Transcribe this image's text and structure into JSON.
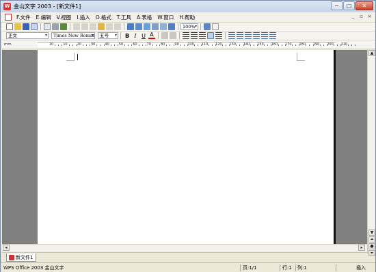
{
  "window": {
    "title": "金山文字 2003 - [新文件1]",
    "controls": {
      "minimize": "─",
      "maximize": "□",
      "close": "✕"
    }
  },
  "menu": {
    "items": [
      "F.文件",
      "E.编辑",
      "V.视图",
      "I.插入",
      "O.格式",
      "T.工具",
      "A.表格",
      "W.窗口",
      "H.帮助"
    ],
    "right_controls": [
      "_",
      "▫",
      "×"
    ]
  },
  "toolbar1": {
    "zoom": "100%"
  },
  "toolbar2": {
    "style": "正文",
    "font": "Times New Roman",
    "size": "五号",
    "bold": "B",
    "italic": "I",
    "underline": "U",
    "font_color": "A"
  },
  "ruler": {
    "unit_label": "mm",
    "labels": [
      "10",
      "10",
      "20",
      "30",
      "40",
      "50",
      "60",
      "70",
      "80",
      "90",
      "100",
      "110",
      "120",
      "130",
      "140",
      "150",
      "160",
      "170",
      "180",
      "190",
      "200",
      "210"
    ]
  },
  "tabs": [
    {
      "label": "新文件1"
    }
  ],
  "status": {
    "product": "WPS Office 2003 金山文字",
    "page": "页:1/1",
    "row": "行:1",
    "col": "列:1",
    "mode": "插入"
  },
  "icons": {
    "toolbar1": [
      "new-icon",
      "open-icon",
      "save-icon",
      "email-icon",
      "print-preview-icon",
      "print-icon",
      "spellcheck-icon",
      "cut-icon",
      "copy-icon",
      "paste-icon",
      "format-painter-icon",
      "undo-icon",
      "redo-icon",
      "hyperlink-icon",
      "table-icon",
      "insert-picture-icon",
      "columns-icon",
      "text-box-icon",
      "drawing-icon",
      "zoom-icon",
      "help-icon",
      "select-icon"
    ],
    "toolbar2": [
      "align-left-icon",
      "align-center-icon",
      "align-right-icon",
      "justify-icon",
      "distributed-icon",
      "numbering-icon",
      "bullets-icon",
      "decrease-indent-icon",
      "increase-indent-icon",
      "line-spacing-icon",
      "paragraph-spacing-icon"
    ]
  },
  "colors": {
    "title_bar": "#c5d5e9",
    "page": "#ffffff",
    "workspace": "#808080",
    "close_button": "#c8412b"
  }
}
